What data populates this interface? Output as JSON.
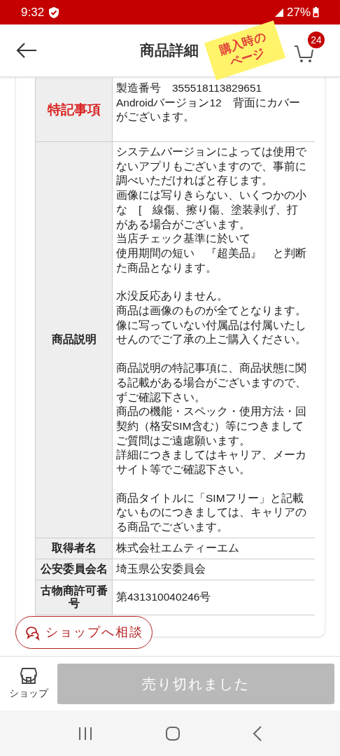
{
  "status_bar": {
    "time": "9:32",
    "battery": "27%"
  },
  "header": {
    "title": "商品詳細",
    "cart_count": "24",
    "sticky_note": [
      "購入時の",
      "ページ"
    ]
  },
  "table": {
    "rows": [
      {
        "label": "特記事項",
        "emphasis": true,
        "paragraphs": [
          [
            "製造番号　355518113829651",
            "Androidバージョン12　背面にカバー",
            "がございます。"
          ]
        ]
      },
      {
        "label": "商品説明",
        "emphasis": false,
        "paragraphs": [
          [
            "システムバージョンによっては使用で",
            "ないアプリもございますので、事前に",
            "調べいただければと存じます。",
            "画像には写りきらない、いくつかの小",
            "な　[　線傷、擦り傷、塗装剥げ、打",
            "がある場合がございます。",
            "当店チェック基準に於いて",
            "使用期間の短い　『超美品』　と判断",
            "た商品となります。"
          ],
          [
            "水没反応ありません。",
            "商品は画像のものが全てとなります。",
            "像に写っていない付属品は付属いたし",
            "せんのでご了承の上ご購入ください。"
          ],
          [
            "商品説明の特記事項に、商品状態に関",
            "る記載がある場合がございますので、",
            "ずご確認下さい。",
            "商品の機能・スペック・使用方法・回",
            "契約（格安SIM含む）等につきまして",
            "ご質問はご遠慮願います。",
            "詳細につきましてはキャリア、メーカ",
            "サイト等でご確認下さい。"
          ],
          [
            "商品タイトルに「SIMフリー」と記載",
            "ないものにつきましては、キャリアの",
            "る商品でございます。"
          ]
        ]
      },
      {
        "label": "取得者名",
        "emphasis": false,
        "paragraphs": [
          [
            "株式会社エムティーエム"
          ]
        ]
      },
      {
        "label": "公安委員会名",
        "emphasis": false,
        "paragraphs": [
          [
            "埼玉県公安委員会"
          ]
        ]
      },
      {
        "label": "古物商許可番号",
        "emphasis": false,
        "paragraphs": [
          [
            "第431310040246号"
          ]
        ]
      }
    ]
  },
  "consult_button": "ショップへ相談",
  "bottom_bar": {
    "shop_label": "ショップ",
    "buy_button": {
      "label": "売り切れました",
      "disabled": true
    }
  }
}
